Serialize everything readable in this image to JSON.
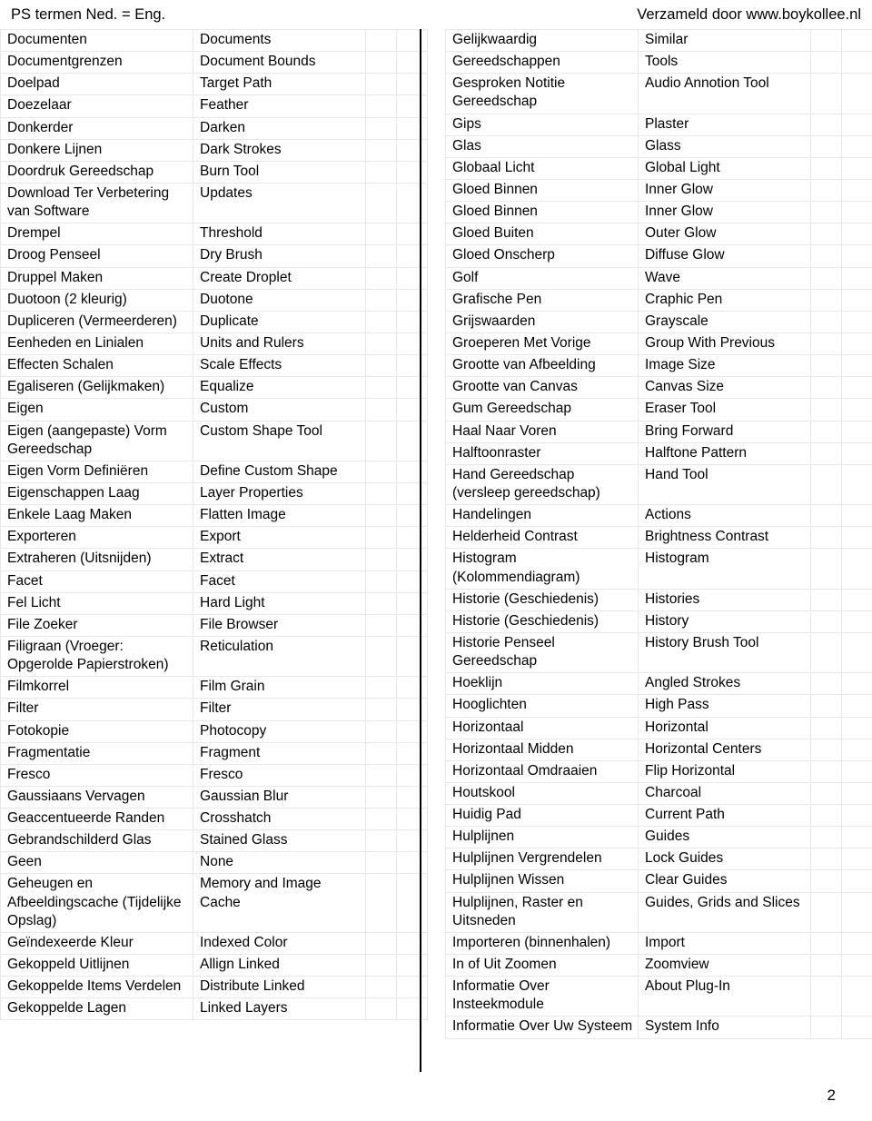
{
  "runhead": {
    "left": "PS termen Ned. = Eng.",
    "right": "Verzameld door www.boykollee.nl"
  },
  "page_number": "2",
  "tables": {
    "left": [
      {
        "term": "Documenten",
        "translation": "Documents"
      },
      {
        "term": "Documentgrenzen",
        "translation": "Document Bounds"
      },
      {
        "term": "Doelpad",
        "translation": "Target Path"
      },
      {
        "term": "Doezelaar",
        "translation": "Feather"
      },
      {
        "term": "Donkerder",
        "translation": "Darken"
      },
      {
        "term": "Donkere Lijnen",
        "translation": "Dark Strokes"
      },
      {
        "term": "Doordruk Gereedschap",
        "translation": "Burn Tool"
      },
      {
        "term": "Download Ter Verbetering van Software",
        "translation": "Updates"
      },
      {
        "term": "Drempel",
        "translation": "Threshold"
      },
      {
        "term": "Droog Penseel",
        "translation": "Dry Brush"
      },
      {
        "term": "Druppel Maken",
        "translation": "Create Droplet"
      },
      {
        "term": "Duotoon (2 kleurig)",
        "translation": "Duotone"
      },
      {
        "term": "Dupliceren (Vermeerderen)",
        "translation": "Duplicate"
      },
      {
        "term": "Eenheden en Linialen",
        "translation": "Units and Rulers"
      },
      {
        "term": "Effecten Schalen",
        "translation": "Scale Effects"
      },
      {
        "term": "Egaliseren (Gelijkmaken)",
        "translation": "Equalize"
      },
      {
        "term": "Eigen",
        "translation": "Custom"
      },
      {
        "term": "Eigen (aangepaste) Vorm Gereedschap",
        "translation": "Custom Shape Tool"
      },
      {
        "term": "Eigen Vorm Definiëren",
        "translation": "Define Custom Shape"
      },
      {
        "term": "Eigenschappen Laag",
        "translation": "Layer Properties"
      },
      {
        "term": "Enkele Laag Maken",
        "translation": "Flatten Image"
      },
      {
        "term": "Exporteren",
        "translation": "Export"
      },
      {
        "term": "Extraheren (Uitsnijden)",
        "translation": "Extract"
      },
      {
        "term": "Facet",
        "translation": "Facet"
      },
      {
        "term": "Fel Licht",
        "translation": "Hard Light"
      },
      {
        "term": "File Zoeker",
        "translation": "File Browser"
      },
      {
        "term": "Filigraan (Vroeger: Opgerolde Papierstroken)",
        "translation": "Reticulation"
      },
      {
        "term": "Filmkorrel",
        "translation": "Film Grain"
      },
      {
        "term": "Filter",
        "translation": "Filter"
      },
      {
        "term": "Fotokopie",
        "translation": "Photocopy"
      },
      {
        "term": "Fragmentatie",
        "translation": "Fragment"
      },
      {
        "term": "Fresco",
        "translation": "Fresco"
      },
      {
        "term": "Gaussiaans Vervagen",
        "translation": "Gaussian Blur"
      },
      {
        "term": "Geaccentueerde Randen",
        "translation": "Crosshatch"
      },
      {
        "term": "Gebrandschilderd Glas",
        "translation": "Stained Glass"
      },
      {
        "term": "Geen",
        "translation": "None"
      },
      {
        "term": "Geheugen en Afbeeldingscache (Tijdelijke Opslag)",
        "translation": "Memory and Image Cache"
      },
      {
        "term": "Geïndexeerde Kleur",
        "translation": "Indexed Color"
      },
      {
        "term": "Gekoppeld Uitlijnen",
        "translation": "Allign Linked"
      },
      {
        "term": "Gekoppelde Items Verdelen",
        "translation": "Distribute Linked"
      },
      {
        "term": "Gekoppelde Lagen",
        "translation": "Linked Layers"
      }
    ],
    "right": [
      {
        "term": "Gelijkwaardig",
        "translation": "Similar"
      },
      {
        "term": "Gereedschappen",
        "translation": "Tools"
      },
      {
        "term": "Gesproken Notitie Gereedschap",
        "translation": "Audio Annotion Tool"
      },
      {
        "term": "Gips",
        "translation": "Plaster"
      },
      {
        "term": "Glas",
        "translation": "Glass"
      },
      {
        "term": "Globaal Licht",
        "translation": "Global Light"
      },
      {
        "term": "Gloed Binnen",
        "translation": "Inner Glow"
      },
      {
        "term": "Gloed Binnen",
        "translation": "Inner Glow"
      },
      {
        "term": "Gloed Buiten",
        "translation": "Outer Glow"
      },
      {
        "term": "Gloed Onscherp",
        "translation": "Diffuse Glow"
      },
      {
        "term": "Golf",
        "translation": "Wave"
      },
      {
        "term": "Grafische Pen",
        "translation": "Craphic Pen"
      },
      {
        "term": "Grijswaarden",
        "translation": "Grayscale"
      },
      {
        "term": "Groeperen Met Vorige",
        "translation": "Group With Previous"
      },
      {
        "term": "Grootte van Afbeelding",
        "translation": "Image Size"
      },
      {
        "term": "Grootte van Canvas",
        "translation": "Canvas Size"
      },
      {
        "term": "Gum Gereedschap",
        "translation": "Eraser Tool"
      },
      {
        "term": "Haal Naar Voren",
        "translation": "Bring Forward"
      },
      {
        "term": "Halftoonraster",
        "translation": "Halftone Pattern"
      },
      {
        "term": "Hand Gereedschap (versleep gereedschap)",
        "translation": "Hand Tool"
      },
      {
        "term": "Handelingen",
        "translation": "Actions"
      },
      {
        "term": "Helderheid Contrast",
        "translation": "Brightness Contrast"
      },
      {
        "term": "Histogram (Kolommendiagram)",
        "translation": "Histogram"
      },
      {
        "term": "Historie (Geschiedenis)",
        "translation": "Histories"
      },
      {
        "term": "Historie (Geschiedenis)",
        "translation": "History"
      },
      {
        "term": "Historie Penseel Gereedschap",
        "translation": "History Brush Tool"
      },
      {
        "term": "Hoeklijn",
        "translation": "Angled Strokes"
      },
      {
        "term": "Hooglichten",
        "translation": "High Pass"
      },
      {
        "term": "Horizontaal",
        "translation": "Horizontal"
      },
      {
        "term": "Horizontaal Midden",
        "translation": "Horizontal Centers"
      },
      {
        "term": "Horizontaal Omdraaien",
        "translation": "Flip Horizontal"
      },
      {
        "term": "Houtskool",
        "translation": "Charcoal"
      },
      {
        "term": "Huidig Pad",
        "translation": "Current Path"
      },
      {
        "term": "Hulplijnen",
        "translation": "Guides"
      },
      {
        "term": "Hulplijnen Vergrendelen",
        "translation": "Lock Guides"
      },
      {
        "term": "Hulplijnen Wissen",
        "translation": "Clear Guides"
      },
      {
        "term": "Hulplijnen, Raster en Uitsneden",
        "translation": "Guides, Grids and Slices"
      },
      {
        "term": "Importeren (binnenhalen)",
        "translation": "Import"
      },
      {
        "term": "In of Uit Zoomen",
        "translation": "Zoomview"
      },
      {
        "term": "Informatie Over Insteekmodule",
        "translation": "About Plug-In"
      },
      {
        "term": "Informatie Over Uw Systeem",
        "translation": "System Info"
      }
    ]
  }
}
